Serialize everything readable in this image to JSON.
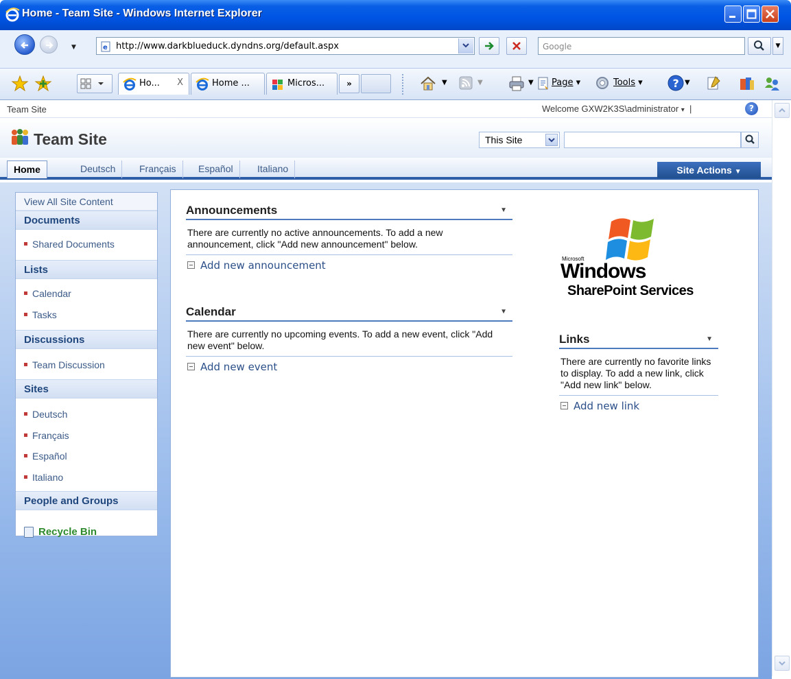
{
  "window": {
    "title": "Home - Team Site - Windows Internet Explorer"
  },
  "address": {
    "url": "http://www.darkblueduck.dyndns.org/default.aspx",
    "search_placeholder": "Google"
  },
  "tabs": [
    {
      "label": "Ho...",
      "active": true
    },
    {
      "label": "Home ...",
      "active": false
    },
    {
      "label": "Micros...",
      "active": false
    }
  ],
  "tabs_more": "»",
  "commands": {
    "page": "Page",
    "tools": "Tools"
  },
  "sp": {
    "breadcrumb": "Team Site",
    "welcome": "Welcome GXW2K3S\\administrator",
    "site_name": "Team Site",
    "scope": "This Site",
    "nav": [
      "Home",
      "Deutsch",
      "Français",
      "Español",
      "Italiano"
    ],
    "site_actions": "Site Actions"
  },
  "quick_launch": {
    "view_all": "View All Site Content",
    "sections": [
      {
        "title": "Documents",
        "items": [
          "Shared Documents"
        ]
      },
      {
        "title": "Lists",
        "items": [
          "Calendar",
          "Tasks"
        ]
      },
      {
        "title": "Discussions",
        "items": [
          "Team Discussion"
        ]
      },
      {
        "title": "Sites",
        "items": [
          "Deutsch",
          "Français",
          "Español",
          "Italiano"
        ]
      },
      {
        "title": "People and Groups",
        "items": []
      }
    ],
    "recycle_bin": "Recycle Bin"
  },
  "webparts": {
    "announcements": {
      "title": "Announcements",
      "body": "There are currently no active announcements. To add a new announcement, click \"Add new announcement\" below.",
      "add": "Add new announcement"
    },
    "calendar": {
      "title": "Calendar",
      "body": "There are currently no upcoming events. To add a new event, click \"Add new event\" below.",
      "add": "Add new event"
    },
    "links": {
      "title": "Links",
      "body": "There are currently no favorite links to display. To add a new link, click \"Add new link\" below.",
      "add": "Add new link"
    }
  },
  "brand": {
    "microsoft": "Microsoft",
    "windows": "Windows",
    "product": "SharePoint Services"
  },
  "icons": [
    "ie-icon",
    "back-icon",
    "forward-icon",
    "go-icon",
    "stop-icon",
    "search-icon",
    "favorites-star-icon",
    "add-favorites-icon",
    "quick-tabs-icon",
    "home-icon",
    "rss-icon",
    "print-icon",
    "page-icon",
    "tools-icon",
    "help-icon",
    "research-icon",
    "team-site-logo-icon",
    "recycle-bin-icon",
    "windows-flag-icon"
  ]
}
